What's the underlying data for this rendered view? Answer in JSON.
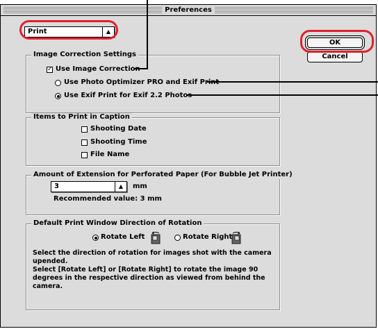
{
  "window": {
    "title": "Preferences"
  },
  "mode_popup": {
    "value": "Print"
  },
  "buttons": {
    "ok": "OK",
    "cancel": "Cancel"
  },
  "image_correction": {
    "title": "Image Correction Settings",
    "use_label": "Use Image Correction",
    "use_checked": true,
    "options": [
      {
        "label": "Use Photo Optimizer PRO and Exif Print",
        "selected": false
      },
      {
        "label": "Use Exif Print for Exif 2.2 Photos",
        "selected": true
      }
    ]
  },
  "caption": {
    "title": "Items to Print in Caption",
    "items": [
      {
        "label": "Shooting Date",
        "checked": false
      },
      {
        "label": "Shooting Time",
        "checked": false
      },
      {
        "label": "File Name",
        "checked": false
      }
    ]
  },
  "extension": {
    "title": "Amount of Extension for Perforated Paper (For Bubble Jet Printer)",
    "value": "3",
    "unit": "mm",
    "recommended": "Recommended value: 3 mm"
  },
  "rotation": {
    "title": "Default Print Window Direction of Rotation",
    "options": [
      {
        "label": "Rotate Left",
        "selected": true
      },
      {
        "label": "Rotate Right",
        "selected": false
      }
    ],
    "description_1": "Select the direction of rotation for images shot with the camera upended.",
    "description_2": "Select [Rotate Left] or [Rotate Right] to rotate the image 90 degrees in the respective direction as viewed from behind the camera."
  },
  "colors": {
    "annotation_red": "#e0202e",
    "window_bg": "#dcdcdc"
  },
  "icons": [
    "camera-rotate-left-icon",
    "camera-rotate-right-icon",
    "popup-arrows-icon"
  ]
}
